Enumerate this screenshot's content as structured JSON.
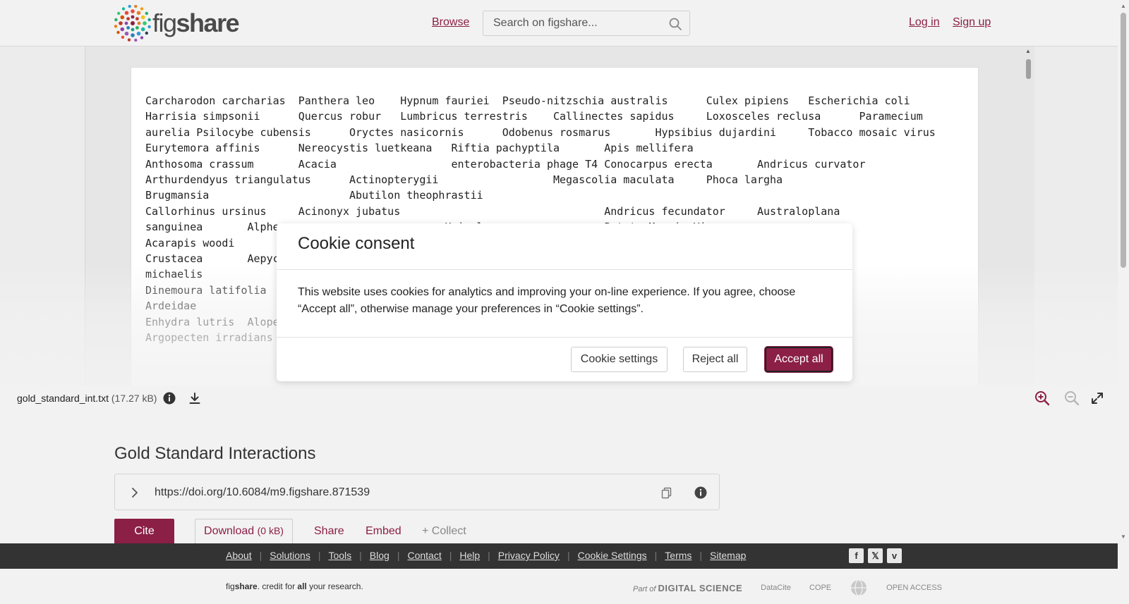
{
  "header": {
    "logo_light": "fig",
    "logo_bold": "share",
    "browse_label": "Browse",
    "search_placeholder": "Search on figshare...",
    "login_label": "Log in",
    "signup_label": "Sign up",
    "brand_color": "#8b1f45"
  },
  "viewer": {
    "file_text": "Carcharodon carcharias  Panthera leo    Hypnum fauriei  Pseudo-nitzschia australis      Culex pipiens   Escherichia coli\nHarrisia simpsonii      Quercus robur   Lumbricus terrestris    Callinectes sapidus     Loxosceles reclusa      Paramecium\naurelia Psilocybe cubensis      Oryctes nasicornis      Odobenus rosmarus       Hypsibius dujardini     Tobacco mosaic virus\nEurytemora affinis      Nereocystis luetkeana   Riftia pachyptila       Apis mellifera\nAnthosoma crassum       Acacia                  enterobacteria phage T4 Conocarpus erecta       Andricus curvator\nArthurdendyus triangulatus      Actinopterygii                  Megascolia maculata     Phoca largha\nBrugmansia                      Abutilon theophrastii\nCallorhinus ursinus     Acinonyx jubatus                                Andricus fecundator     Australoplana\nsanguinea       Alphe...                       Heinel...                Potato Mosaic Vi...\nAcarapis woodi\nCrustacea       Aepyc...                                                                        Ameson\nmichaelis                                                                                       Acer negundo\nDinemoura latifolia\nArdeidae                                                                                        Acer saccharum\nEnhydra lutris  Alopex\nArgopecten irradians                                                                            Achreia",
    "file_name": "gold_standard_int.txt",
    "file_size": "(17.27 kB)"
  },
  "modal": {
    "title": "Cookie consent",
    "body": "This website uses cookies for analytics and improving your on-line experience. If you agree, choose “Accept all”, otherwise manage your preferences in “Cookie settings”.",
    "settings_label": "Cookie settings",
    "reject_label": "Reject all",
    "accept_label": "Accept all"
  },
  "item": {
    "title": "Gold Standard Interactions",
    "doi": "https://doi.org/10.6084/m9.figshare.871539",
    "cite_label": "Cite",
    "download_label": "Download",
    "download_size": "(0 kB)",
    "share_label": "Share",
    "embed_label": "Embed",
    "collect_label": "+ Collect"
  },
  "footer": {
    "links": [
      "About",
      "Solutions",
      "Tools",
      "Blog",
      "Contact",
      "Help",
      "Privacy Policy",
      "Cookie Settings",
      "Terms",
      "Sitemap"
    ],
    "social": [
      "f",
      "𝕏",
      "v"
    ],
    "tagline_pre": "fig",
    "tagline_bold": "share",
    "tagline_mid": ". credit for ",
    "tagline_all": "all",
    "tagline_post": " your research.",
    "partner_ds_pre": "Part of",
    "partner_ds": "DIGITAL SCIENCE",
    "partner_datacite": "DataCite",
    "partner_cope": "COPE",
    "partner_openaccess": "OPEN ACCESS"
  }
}
